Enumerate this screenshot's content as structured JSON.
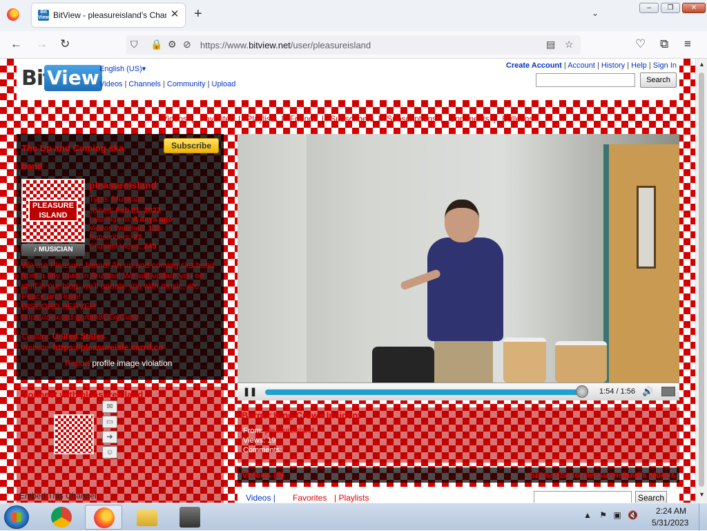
{
  "browser": {
    "tab_title": "BitView - pleasureisland's Chann",
    "url_host": "https://www.",
    "url_domain": "bitview.net",
    "url_path": "/user/pleasureisland",
    "favicon_text": "Bit View"
  },
  "site": {
    "logo_bit": "Bit",
    "logo_view": "View",
    "language": "English (US)▾",
    "main_links": [
      "Videos",
      "Channels",
      "Community",
      "Upload"
    ],
    "top_links": [
      "Create Account",
      "Account",
      "History",
      "Help",
      "Sign In"
    ],
    "search_button": "Search"
  },
  "channel_tabs": [
    "Videos",
    "Favorites",
    "Playlists",
    "Friends",
    "Subscribers",
    "Subscriptions",
    "Comments",
    "Bulletins"
  ],
  "profile": {
    "channel_title": "The Up and Coming ska band",
    "subscribe_label": "Subscribe",
    "avatar_text": "PLEASURE ISLAND",
    "badge": "MUSICIAN",
    "username": "pleasureisland",
    "type_label": "Type:",
    "type_value": "Musician",
    "stats": [
      {
        "label": "Joined:",
        "value": "Feb 21, 2023"
      },
      {
        "label": "Last Sign In:",
        "value": "8 days ago"
      },
      {
        "label": "Videos Watched:",
        "value": "136"
      },
      {
        "label": "Subscribers:",
        "value": "21"
      },
      {
        "label": "Channel Views:",
        "value": "249"
      }
    ],
    "description": "We are Pleasure Island! An up and coming ska band from a tiny town in Arizona! We will update you on stuff in our blog, we'll update you with music, etc. Peace and love!",
    "discord_label": "DISCORD SERVER",
    "discord_link": "https://discord.gg/bm8CGyCvnb",
    "country_label": "Country:",
    "country_value": "United States",
    "website_label": "Website:",
    "website_value": "https://pleasureisle.carrd.co",
    "report_word": "Report",
    "report_rest": "profile image violation"
  },
  "connect": {
    "title": "Connect with pleasureisland",
    "embed_label": "Embed This Channel:"
  },
  "player": {
    "time": "1:54 / 1:56",
    "progress": 0.983
  },
  "video_info": {
    "title": "Burger King Crown Incident",
    "from_label": "From:",
    "from_value": "pleasureisland",
    "views_label": "Views:",
    "views_value": "19",
    "comments_label": "Comments:"
  },
  "videos_section": {
    "title": "Videos (8)",
    "subscribe_text": "Subscribe to pleasureisland's videos",
    "tab_videos": "Videos |",
    "tab_favorites": "Favorites",
    "tab_playlists": "| Playlists",
    "search_button": "Search"
  },
  "taskbar": {
    "time": "2:24 AM",
    "date": "5/31/2023"
  }
}
